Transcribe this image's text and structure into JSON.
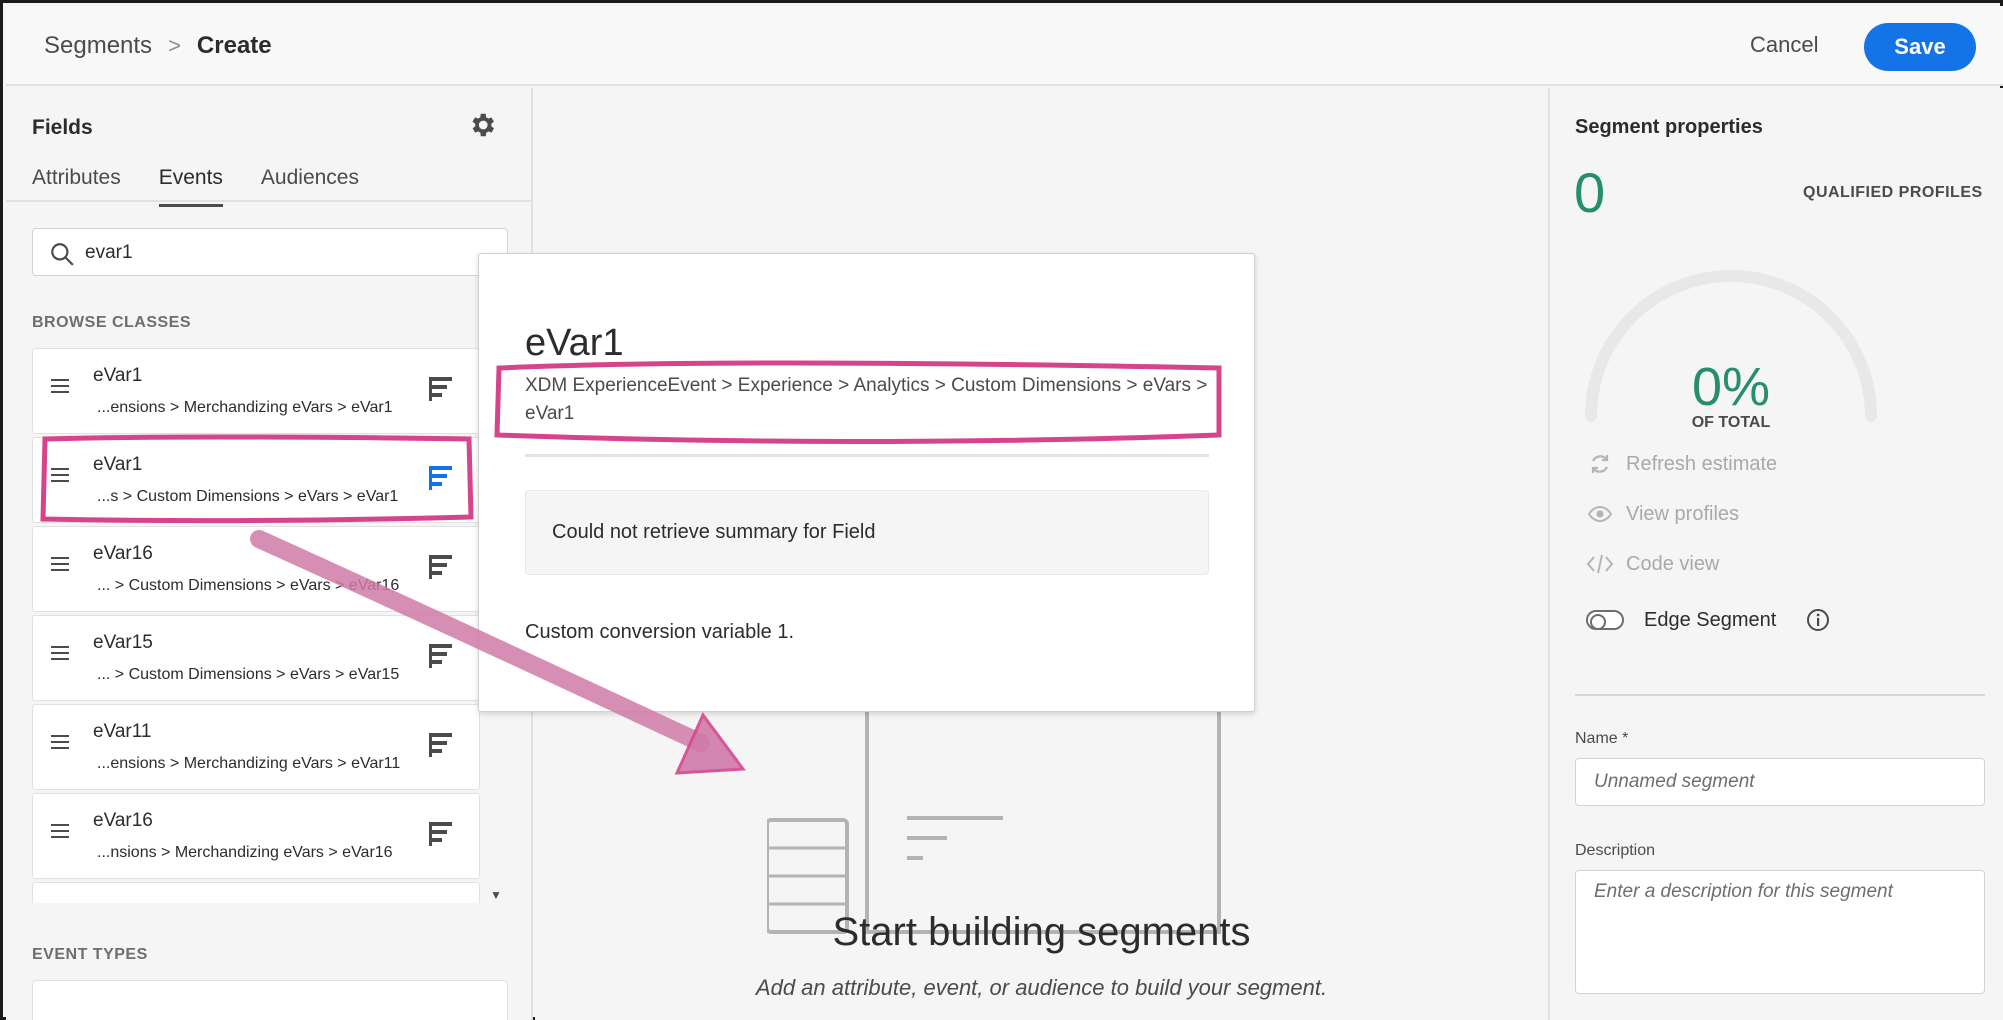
{
  "header": {
    "breadcrumb_parent": "Segments",
    "breadcrumb_separator": ">",
    "breadcrumb_current": "Create",
    "cancel_label": "Cancel",
    "save_label": "Save"
  },
  "fields_panel": {
    "title": "Fields",
    "tabs": [
      {
        "label": "Attributes",
        "active": false
      },
      {
        "label": "Events",
        "active": true
      },
      {
        "label": "Audiences",
        "active": false
      }
    ],
    "search_value": "evar1",
    "browse_classes_label": "BROWSE CLASSES",
    "items": [
      {
        "name": "eVar1",
        "path": "...ensions > Merchandizing eVars > eVar1",
        "highlighted": false
      },
      {
        "name": "eVar1",
        "path": "...s > Custom Dimensions > eVars > eVar1",
        "highlighted": true
      },
      {
        "name": "eVar16",
        "path": "... > Custom Dimensions > eVars > eVar16",
        "highlighted": false
      },
      {
        "name": "eVar15",
        "path": "... > Custom Dimensions > eVars > eVar15",
        "highlighted": false
      },
      {
        "name": "eVar11",
        "path": "...ensions > Merchandizing eVars > eVar11",
        "highlighted": false
      },
      {
        "name": "eVar16",
        "path": "...nsions > Merchandizing eVars > eVar16",
        "highlighted": false
      }
    ],
    "event_types_label": "EVENT TYPES"
  },
  "popover": {
    "title": "eVar1",
    "path": "XDM ExperienceEvent > Experience > Analytics > Custom Dimensions > eVars > eVar1",
    "summary_text": "Could not retrieve summary for Field",
    "description": "Custom conversion variable 1."
  },
  "canvas": {
    "title": "Start building segments",
    "subtitle": "Add an attribute, event, or audience to build your segment."
  },
  "properties": {
    "title": "Segment properties",
    "qualified_count": "0",
    "qualified_label": "QUALIFIED PROFILES",
    "percent": "0%",
    "percent_label": "OF TOTAL",
    "percent_value": 0,
    "refresh_label": "Refresh estimate",
    "view_profiles_label": "View profiles",
    "code_view_label": "Code view",
    "edge_segment_label": "Edge Segment",
    "edge_segment_on": false,
    "name_label": "Name *",
    "name_placeholder": "Unnamed segment",
    "description_label": "Description",
    "description_placeholder": "Enter a description for this segment"
  },
  "colors": {
    "accent": "#1473e6",
    "success_text": "#268e6c",
    "annotation": "#d6458c"
  },
  "icons": {
    "gear": "gear-icon",
    "search": "search-icon",
    "drag": "drag-handle-icon",
    "info": "field-info-icon",
    "refresh": "refresh-icon",
    "eye": "eye-icon",
    "code": "code-icon",
    "info_circle": "info-circle-icon"
  }
}
